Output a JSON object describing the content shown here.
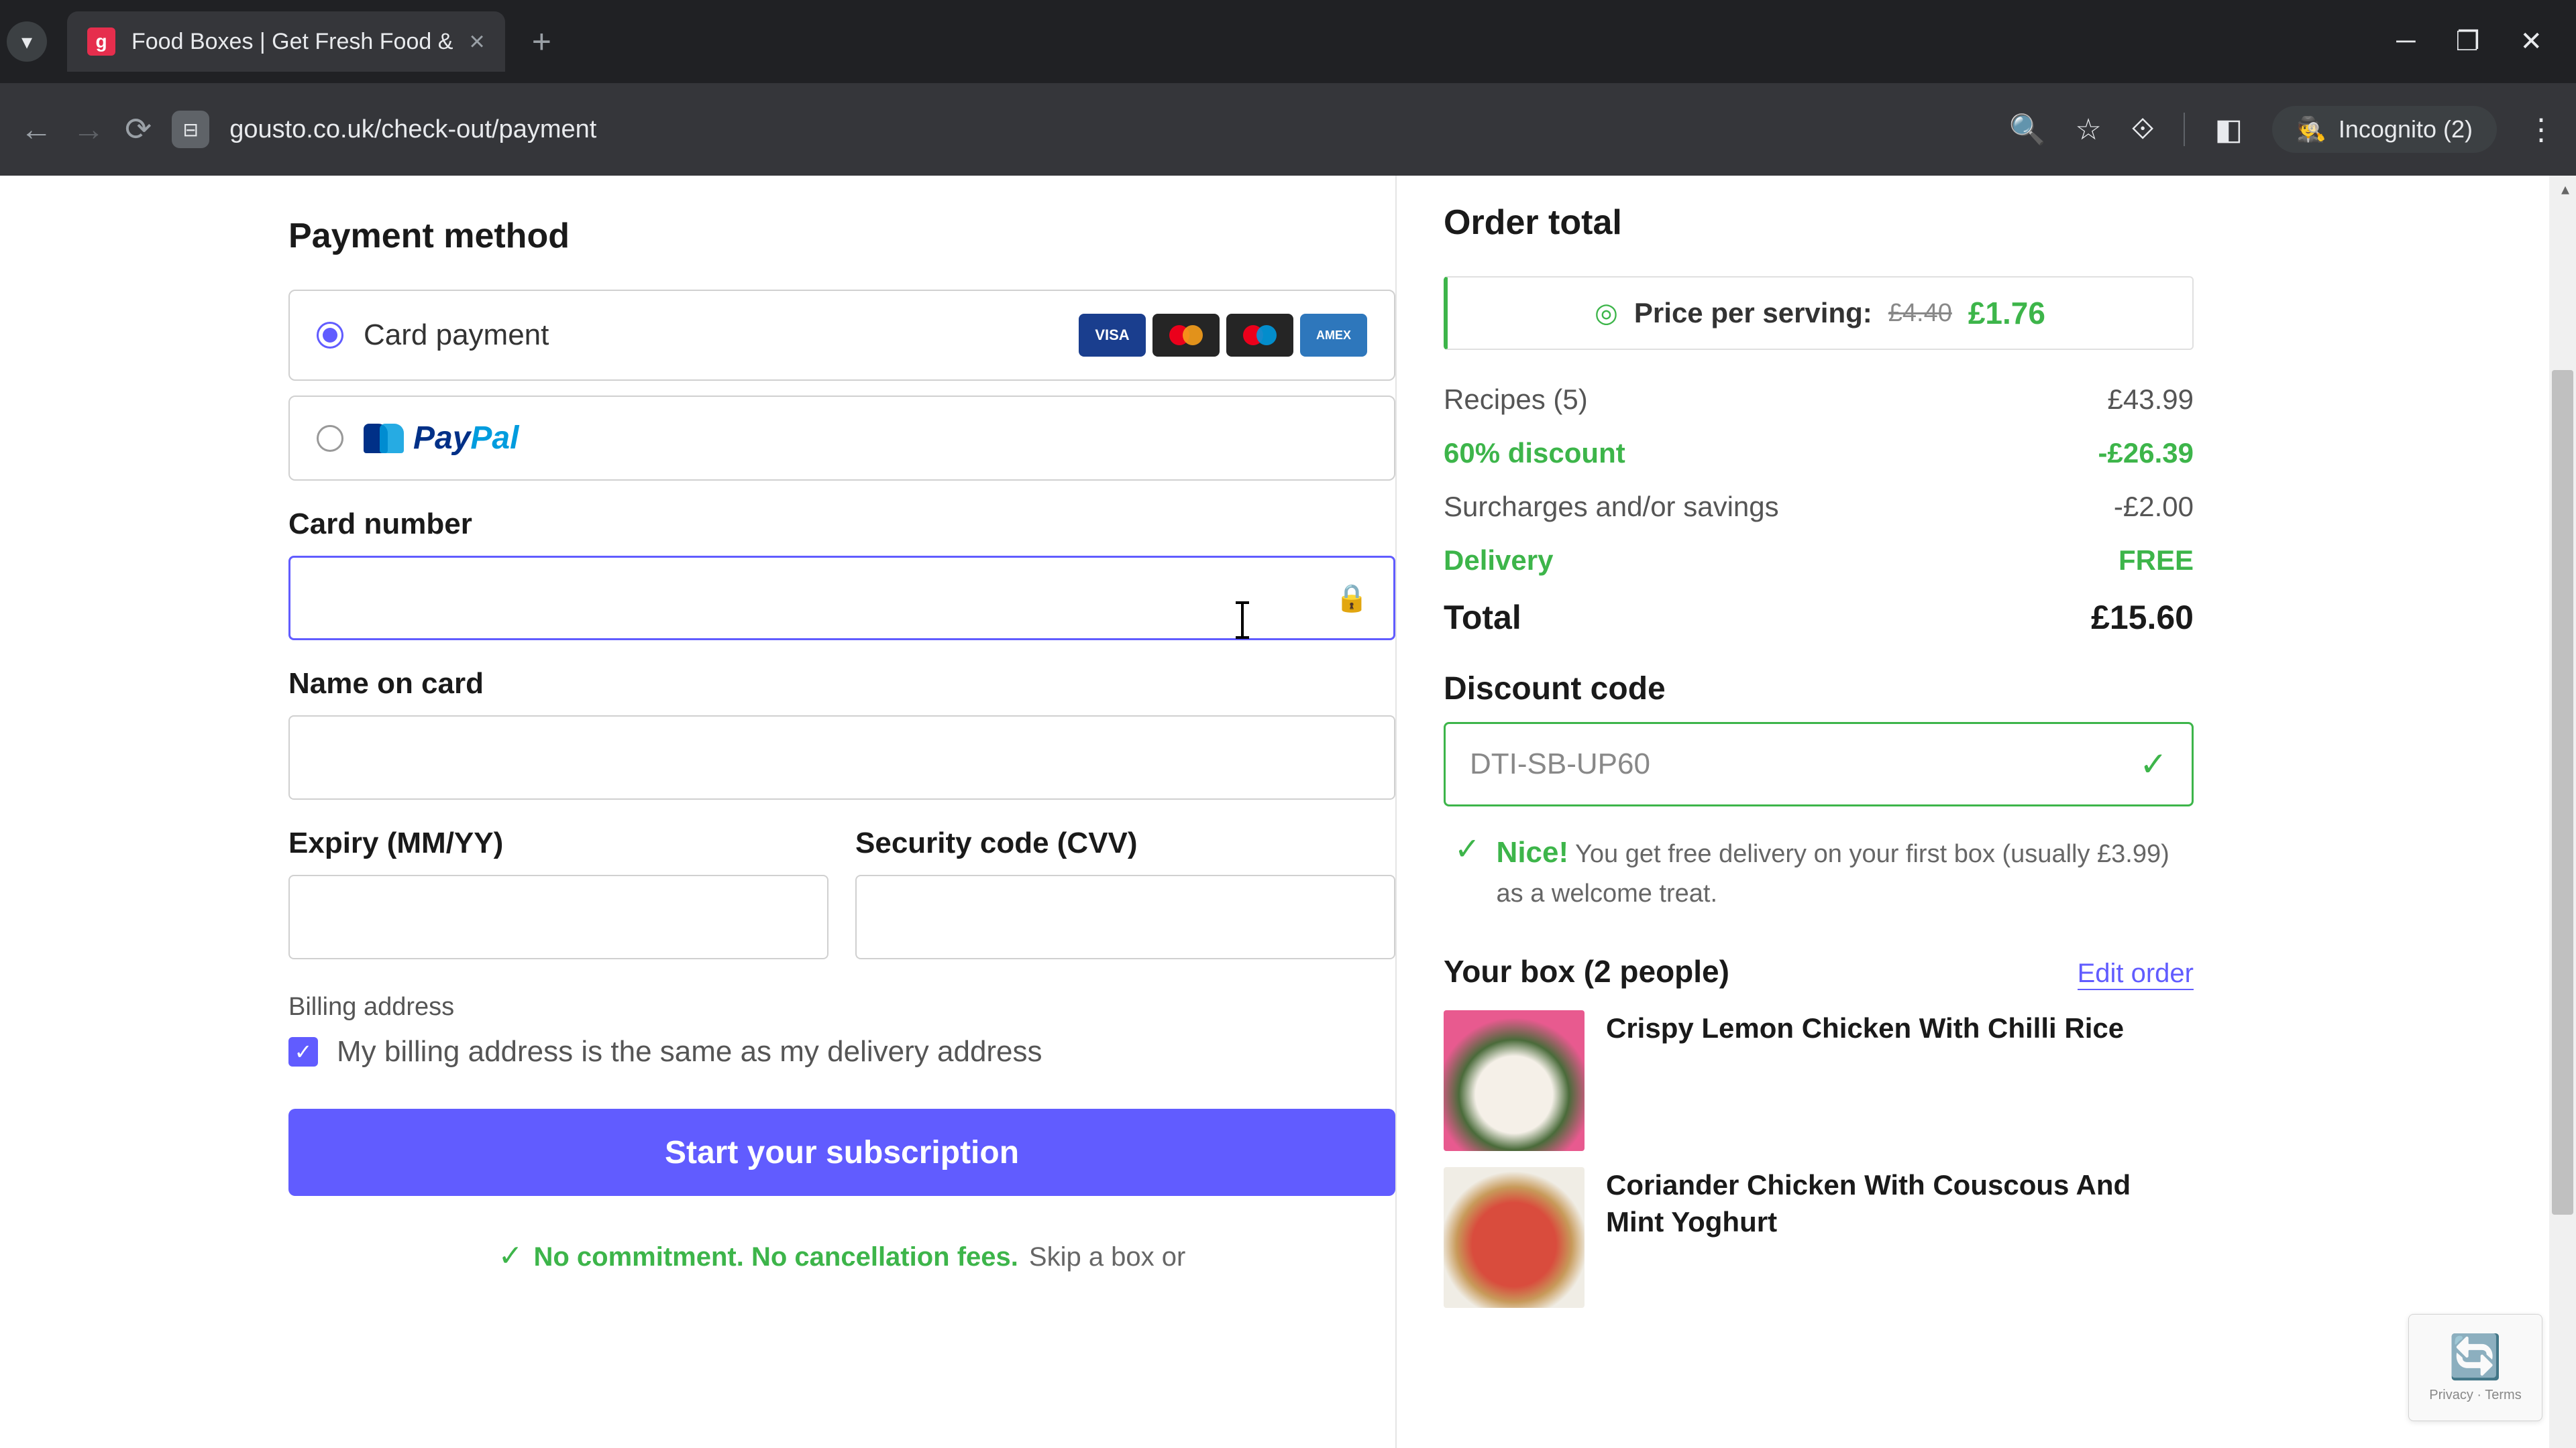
{
  "browser": {
    "tab_title": "Food Boxes | Get Fresh Food &",
    "url": "gousto.co.uk/check-out/payment",
    "incognito": "Incognito (2)"
  },
  "payment": {
    "heading": "Payment method",
    "card_option": "Card payment",
    "paypal_pay": "Pay",
    "paypal_pal": "Pal",
    "card_number_label": "Card number",
    "name_label": "Name on card",
    "expiry_label": "Expiry (MM/YY)",
    "cvv_label": "Security code (CVV)",
    "billing_label": "Billing address",
    "billing_same": "My billing address is the same as my delivery address",
    "cta": "Start your subscription",
    "commitment_bold": "No commitment. No cancellation fees.",
    "commitment_rest": "Skip a box or",
    "visa": "VISA",
    "amex": "AMEX"
  },
  "order": {
    "heading": "Order total",
    "pps_label": "Price per serving:",
    "pps_old": "£4.40",
    "pps_new": "£1.76",
    "lines": [
      {
        "label": "Recipes (5)",
        "value": "£43.99",
        "green": false
      },
      {
        "label": "60% discount",
        "value": "-£26.39",
        "green": true
      },
      {
        "label": "Surcharges and/or savings",
        "value": "-£2.00",
        "green": false
      },
      {
        "label": "Delivery",
        "value": "FREE",
        "green": true
      }
    ],
    "total_label": "Total",
    "total_value": "£15.60",
    "dc_label": "Discount code",
    "dc_value": "DTI-SB-UP60",
    "nice": "Nice!",
    "nice_msg": "You get free delivery on your first box (usually £3.99) as a welcome treat.",
    "box_title": "Your box (2 people)",
    "edit": "Edit order",
    "recipes": [
      "Crispy Lemon Chicken With Chilli Rice",
      "Coriander Chicken With Couscous And Mint Yoghurt"
    ]
  },
  "recaptcha": {
    "privacy": "Privacy",
    "terms": "Terms"
  }
}
